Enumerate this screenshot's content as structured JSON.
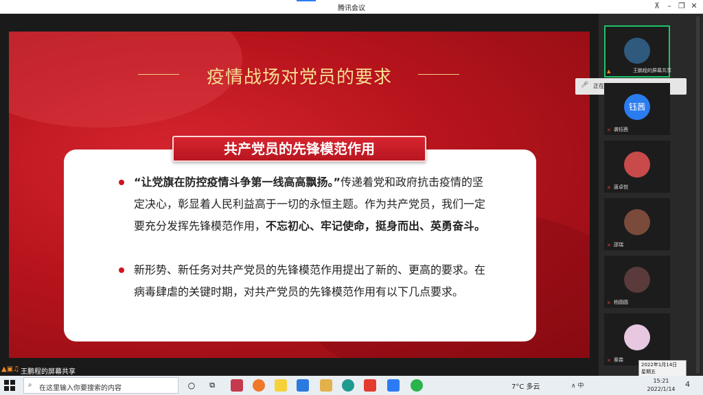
{
  "window": {
    "title": "腾讯会议"
  },
  "slide": {
    "title": "疫情战场对党员的要求",
    "banner": "共产党员的先锋模范作用",
    "para1": {
      "quote": "“让党旗在防控疫情斗争第一线高高飘扬。”",
      "text1": "传递着党和政府抗击疫情的坚定决心，彰显着人民利益高于一切的永恒主题。作为共产党员，我们一定要充分发挥先锋模范作用，",
      "bold": "不忘初心、牢记使命，挺身而出、英勇奋斗。"
    },
    "para2": "新形势、新任务对共产党员的先锋模范作用提出了新的、更高的要求。在病毒肆虐的关键时期，对共产党员的先锋模范作用有以下几点要求。"
  },
  "share_bar": {
    "label": "王鹏程的屏幕共享"
  },
  "sidebar": {
    "speaking": "正在讲话: 王鹏程;",
    "participants": [
      {
        "name": "王鹏程的屏幕共享",
        "avatar_color": "#2f5a7e"
      },
      {
        "name": "袭钰茜",
        "avatar_text": "钰茜",
        "avatar_color": "#2a7cf0"
      },
      {
        "name": "唐卓悦",
        "avatar_color": "#c84a4a"
      },
      {
        "name": "邵瑞",
        "avatar_color": "#7a4a3a"
      },
      {
        "name": "杨圆圆",
        "avatar_color": "#5a3a3a"
      },
      {
        "name": "秦霖",
        "avatar_color": "#e7c8e0"
      }
    ]
  },
  "tooltip": {
    "date": "2022年1月14日",
    "weekday": "星期五"
  },
  "taskbar": {
    "search_placeholder": "在这里输入你要搜索的内容",
    "weather": "7°C 多云",
    "tray": "∧ 中",
    "time": "15:21",
    "date": "2022/1/14",
    "notify": "4"
  }
}
